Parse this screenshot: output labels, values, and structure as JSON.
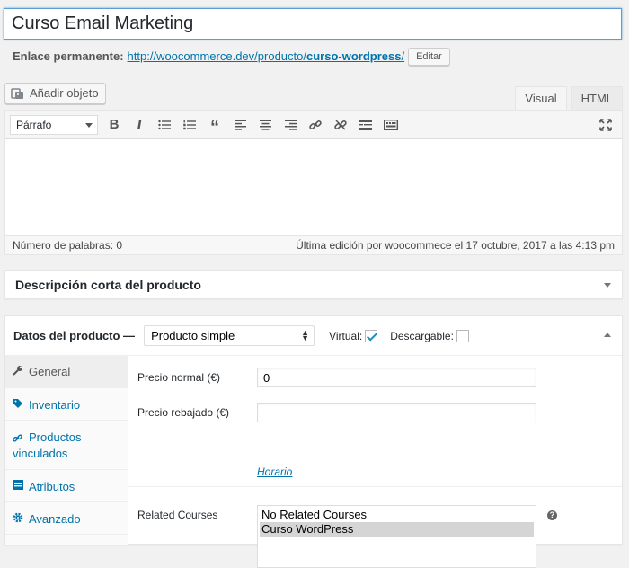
{
  "post": {
    "title_value": "Curso Email Marketing",
    "permalink_label": "Enlace permanente:",
    "permalink_base": "http://woocommerce.dev/producto/",
    "permalink_slug": "curso-wordpress",
    "permalink_trailing": "/",
    "edit_button": "Editar"
  },
  "editor": {
    "add_media_label": "Añadir objeto",
    "tabs": [
      "Visual",
      "HTML"
    ],
    "format_value": "Párrafo",
    "toolbar_icons": [
      "bold-icon",
      "italic-icon",
      "bulleted-list-icon",
      "numbered-list-icon",
      "blockquote-icon",
      "align-left-icon",
      "align-center-icon",
      "align-right-icon",
      "link-icon",
      "unlink-icon",
      "read-more-icon",
      "toolbar-toggle-icon",
      "fullscreen-icon"
    ],
    "word_count": "Número de palabras: 0",
    "last_edit": "Última edición por woocommece el 17 octubre, 2017 a las 4:13 pm"
  },
  "short_description": {
    "title": "Descripción corta del producto"
  },
  "product_data": {
    "title": "Datos del producto —",
    "type_value": "Producto simple",
    "virtual_label": "Virtual:",
    "virtual_checked": true,
    "downloadable_label": "Descargable:",
    "downloadable_checked": false,
    "tabs": [
      {
        "label": "General",
        "icon": "wrench-icon"
      },
      {
        "label": "Inventario",
        "icon": "tag-icon"
      },
      {
        "label": "Productos vinculados",
        "icon": "link-icon"
      },
      {
        "label": "Atributos",
        "icon": "table-icon"
      },
      {
        "label": "Avanzado",
        "icon": "gear-icon"
      }
    ],
    "general": {
      "regular_price_label": "Precio normal (€)",
      "regular_price_value": "0",
      "sale_price_label": "Precio rebajado (€)",
      "sale_price_value": "",
      "schedule_link": "Horario",
      "related_courses_label": "Related Courses",
      "related_courses_options": [
        "No Related Courses",
        "Curso WordPress"
      ],
      "related_courses_selected": "Curso WordPress",
      "help_icon": "?"
    }
  },
  "colors": {
    "link": "#0073aa",
    "focus_border": "#5b9dd9",
    "checkbox_check": "#1e8cbe"
  }
}
